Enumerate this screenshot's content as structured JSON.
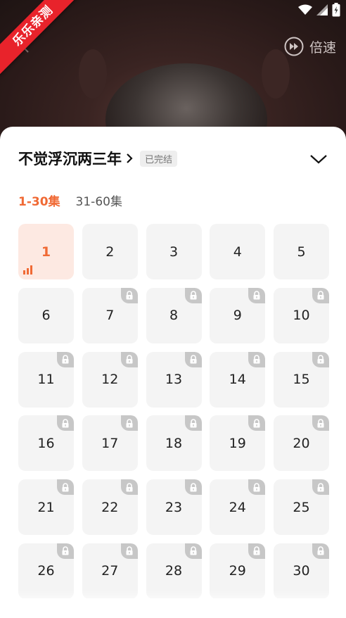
{
  "watermark": "乐乐亲测",
  "player": {
    "speed_label": "倍速"
  },
  "sheet": {
    "title": "不觉浮沉两三年",
    "status_badge": "已完结",
    "tabs": [
      {
        "label": "1-30集",
        "active": true
      },
      {
        "label": "31-60集",
        "active": false
      }
    ],
    "current_episode": 1,
    "episodes": [
      "1",
      "2",
      "3",
      "4",
      "5",
      "6",
      "7",
      "8",
      "9",
      "10",
      "11",
      "12",
      "13",
      "14",
      "15",
      "16",
      "17",
      "18",
      "19",
      "20",
      "21",
      "22",
      "23",
      "24",
      "25",
      "26",
      "27",
      "28",
      "29",
      "30"
    ],
    "locked_from": 7
  },
  "colors": {
    "accent": "#f06a35",
    "watermark": "#e8232b"
  },
  "icons": [
    "back-icon",
    "speed-icon",
    "chevron-right-icon",
    "chevron-down-icon",
    "lock-icon",
    "playing-bars-icon",
    "wifi-icon",
    "signal-icon",
    "battery-icon"
  ]
}
